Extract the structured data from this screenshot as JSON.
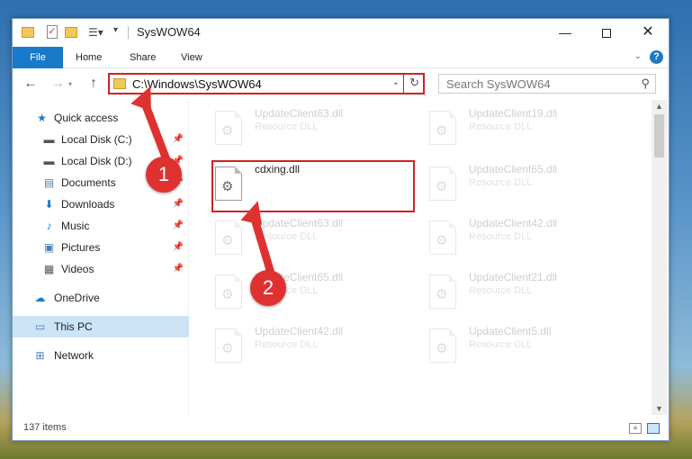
{
  "window": {
    "title": "SysWOW64",
    "buttons": {
      "minimize": "—",
      "close": "✕"
    }
  },
  "ribbon": {
    "tabs": [
      "File",
      "Home",
      "Share",
      "View"
    ],
    "help": "?"
  },
  "nav": {
    "address": "C:\\Windows\\SysWOW64",
    "search_placeholder": "Search SysWOW64"
  },
  "sidebar": {
    "items": [
      {
        "label": "Quick access",
        "icon": "star-icon",
        "pinned": false
      },
      {
        "label": "Local Disk (C:)",
        "icon": "drive-icon",
        "pinned": true
      },
      {
        "label": "Local Disk (D:)",
        "icon": "drive-icon",
        "pinned": true
      },
      {
        "label": "Documents",
        "icon": "documents-icon",
        "pinned": true
      },
      {
        "label": "Downloads",
        "icon": "download-icon",
        "pinned": true
      },
      {
        "label": "Music",
        "icon": "music-icon",
        "pinned": true
      },
      {
        "label": "Pictures",
        "icon": "pictures-icon",
        "pinned": true
      },
      {
        "label": "Videos",
        "icon": "videos-icon",
        "pinned": true
      },
      {
        "label": "OneDrive",
        "icon": "cloud-icon",
        "pinned": false
      },
      {
        "label": "This PC",
        "icon": "pc-icon",
        "pinned": false,
        "selected": true
      },
      {
        "label": "Network",
        "icon": "network-icon",
        "pinned": false
      }
    ]
  },
  "files": [
    {
      "name": "UpdateClient63.dll",
      "type": "Resource DLL",
      "faded": true
    },
    {
      "name": "UpdateClient19.dll",
      "type": "Resource DLL",
      "faded": true
    },
    {
      "name": "cdxing.dll",
      "type": "",
      "faded": false
    },
    {
      "name": "UpdateClient65.dll",
      "type": "Resource DLL",
      "faded": true
    },
    {
      "name": "UpdateClient63.dll",
      "type": "Resource DLL",
      "faded": true
    },
    {
      "name": "UpdateClient42.dll",
      "type": "Resource DLL",
      "faded": true
    },
    {
      "name": "UpdateClient65.dll",
      "type": "Resource DLL",
      "faded": true
    },
    {
      "name": "UpdateClient21.dll",
      "type": "Resource DLL",
      "faded": true
    },
    {
      "name": "UpdateClient42.dll",
      "type": "Resource DLL",
      "faded": true
    },
    {
      "name": "UpdateClient5.dll",
      "type": "Resource DLL",
      "faded": true
    }
  ],
  "status": {
    "items": "137 items"
  },
  "annotations": {
    "step1": "1",
    "step2": "2",
    "color": "#e03131"
  }
}
